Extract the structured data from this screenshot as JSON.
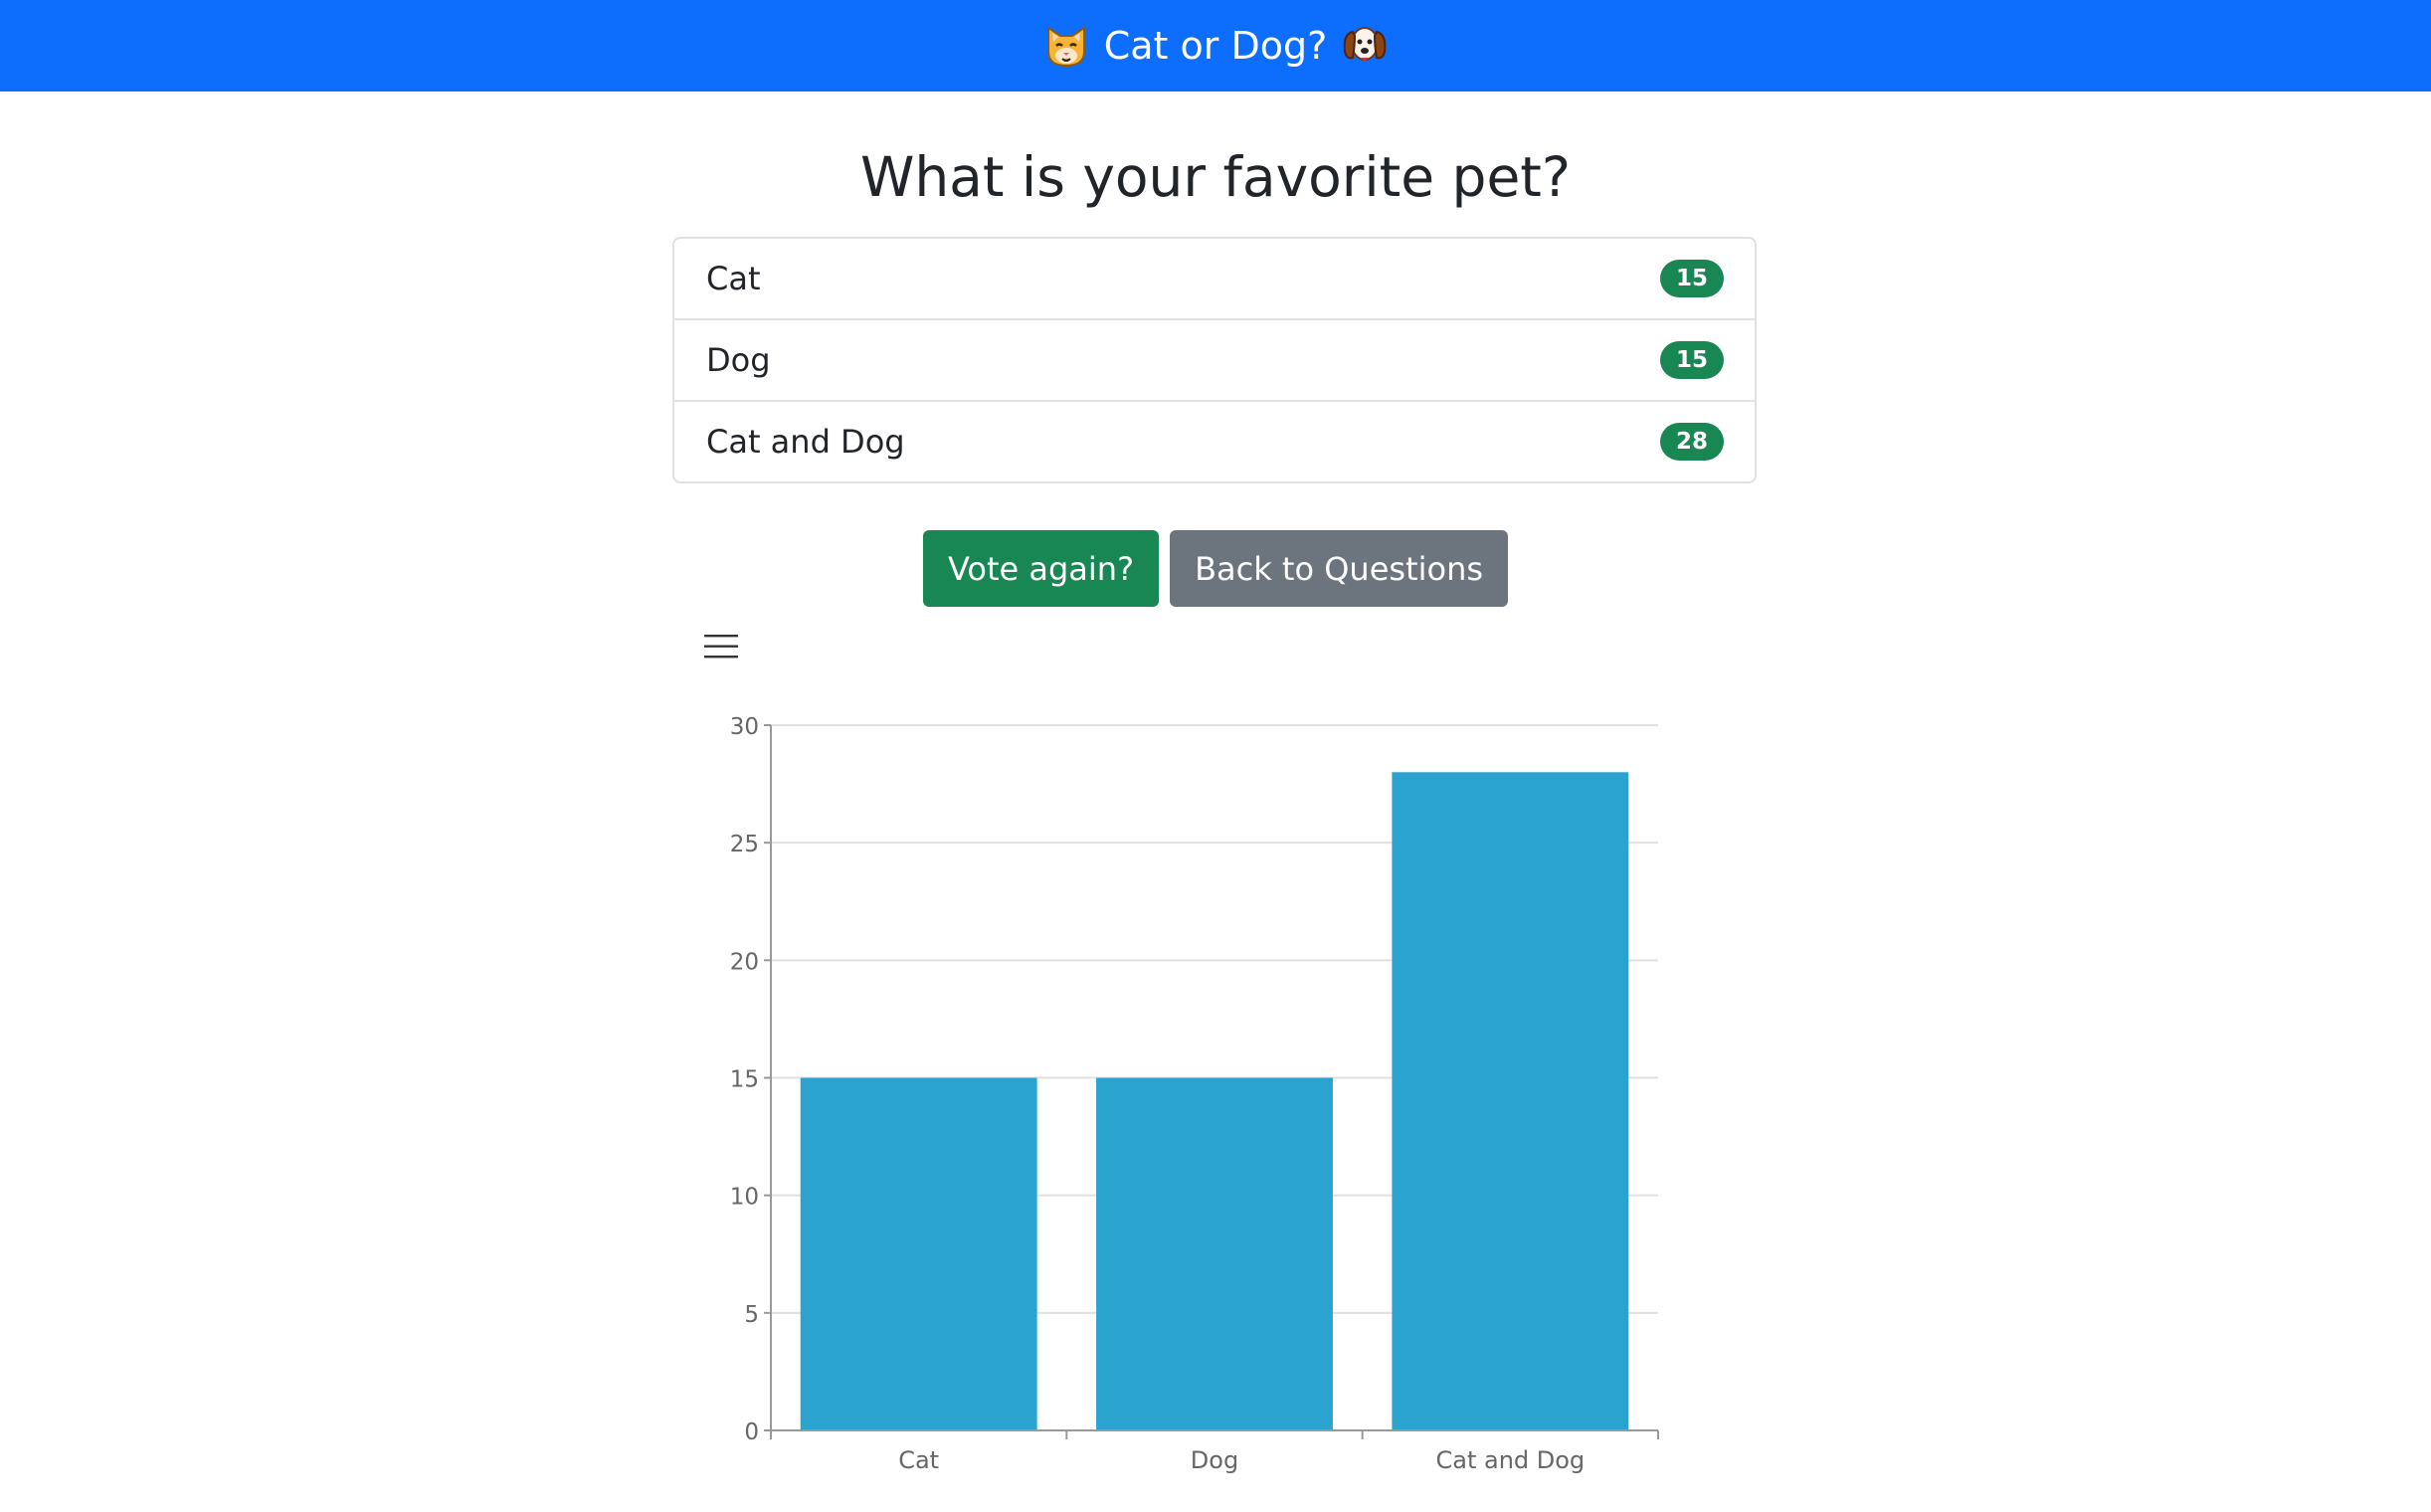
{
  "navbar": {
    "title": "Cat or Dog?",
    "left_icon": "cat-emoji-icon",
    "right_icon": "dog-emoji-icon",
    "color": "#0d6efd"
  },
  "question": {
    "title": "What is your favorite pet?"
  },
  "options": [
    {
      "label": "Cat",
      "votes": "15"
    },
    {
      "label": "Dog",
      "votes": "15"
    },
    {
      "label": "Cat and Dog",
      "votes": "28"
    }
  ],
  "actions": {
    "vote_again_label": "Vote again?",
    "back_label": "Back to Questions"
  },
  "chart_menu": {
    "icon": "hamburger-menu-icon"
  },
  "chart_data": {
    "type": "bar",
    "categories": [
      "Cat",
      "Dog",
      "Cat and Dog"
    ],
    "values": [
      15,
      15,
      28
    ],
    "title": "",
    "xlabel": "",
    "ylabel": "",
    "ylim": [
      0,
      30
    ],
    "yticks": [
      0,
      5,
      10,
      15,
      20,
      25,
      30
    ],
    "grid": true,
    "bar_color": "#2ba3cf"
  },
  "colors": {
    "success": "#198754",
    "secondary": "#6c757d"
  }
}
